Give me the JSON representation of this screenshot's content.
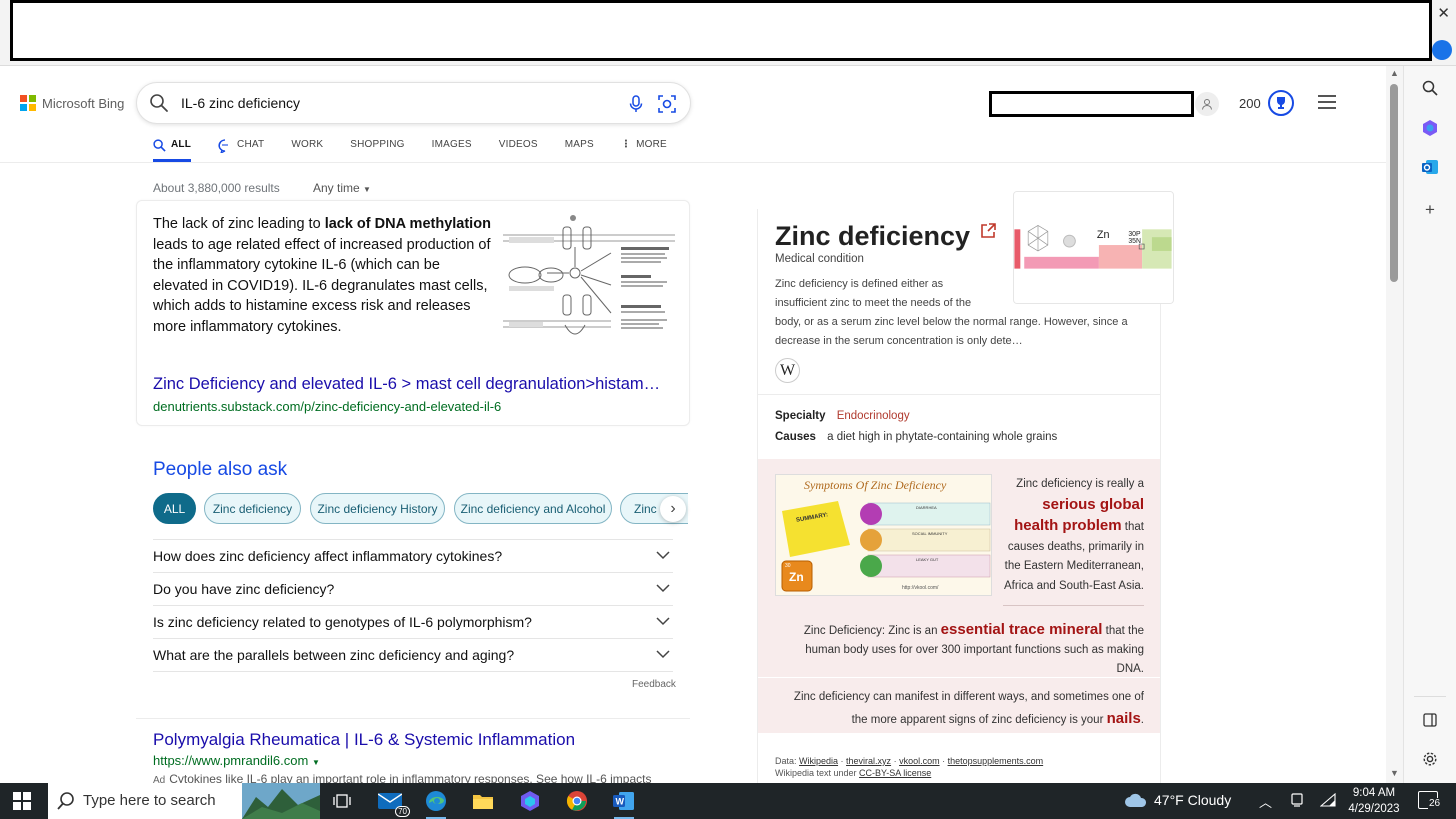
{
  "browser": {
    "close_glyph": "✕"
  },
  "header": {
    "logo_text": "Microsoft Bing",
    "search_query": "IL-6 zinc deficiency",
    "rewards_points": "200"
  },
  "nav_tabs": [
    {
      "label": "ALL",
      "icon": "search-icon",
      "active": true
    },
    {
      "label": "CHAT",
      "icon": "chat-icon",
      "active": false
    },
    {
      "label": "WORK",
      "active": false
    },
    {
      "label": "SHOPPING",
      "active": false
    },
    {
      "label": "IMAGES",
      "active": false
    },
    {
      "label": "VIDEOS",
      "active": false
    },
    {
      "label": "MAPS",
      "active": false
    },
    {
      "label": "MORE",
      "icon": "more-vertical-icon",
      "active": false
    }
  ],
  "results_meta": {
    "count": "About 3,880,000 results",
    "time_filter": "Any time"
  },
  "answer": {
    "text_1": "The lack of zinc leading to ",
    "text_bold_1": "lack of DNA methylation",
    "text_2": " leads to age related effect of increased production of the inflammatory cytokine IL-6 (which can be elevated in COVID19). IL-6 degranulates mast cells, which adds to histamine excess risk and releases more inflammatory cytokines.",
    "title": "Zinc Deficiency and elevated IL-6 > mast cell degranulation>histam…",
    "url": "denutrients.substack.com/p/zinc-deficiency-and-elevated-il-6"
  },
  "people_also_ask": {
    "heading": "People also ask",
    "chips": [
      "ALL",
      "Zinc deficiency",
      "Zinc deficiency History",
      "Zinc deficiency and Alcohol",
      "Zinc d"
    ],
    "questions": [
      "How does zinc deficiency affect inflammatory cytokines?",
      "Do you have zinc deficiency?",
      "Is zinc deficiency related to genotypes of IL-6 polymorphism?",
      "What are the parallels between zinc deficiency and aging?"
    ],
    "feedback": "Feedback"
  },
  "result_2": {
    "title": "Polymyalgia Rheumatica | IL-6 & Systemic Inflammation",
    "url": "https://www.pmrandil6.com",
    "ad_label": "Ad",
    "snippet": "Cytokines like IL-6 play an important role in inflammatory responses. See how IL-6 impacts"
  },
  "knowledge_panel": {
    "title": "Zinc deficiency",
    "subtitle": "Medical condition",
    "description_lines": [
      "Zinc deficiency is defined either as",
      "insufficient zinc to meet the needs of the",
      "body, or as a serum zinc level below the normal range. However, since a",
      "decrease in the serum concentration is only dete…"
    ],
    "wiki_glyph": "W",
    "facts": [
      {
        "key": "Specialty",
        "value": "Endocrinology",
        "is_link": true
      },
      {
        "key": "Causes",
        "value": "a diet high in phytate-containing whole grains",
        "is_link": false
      }
    ],
    "image_labels": {
      "element": "Zn",
      "p": "30P",
      "n": "35N"
    },
    "infographic": {
      "title": "Symptoms Of Zinc Deficiency",
      "summary_label": "SUMMARY:",
      "badge_number": "30",
      "badge_symbol": "Zn",
      "rows": [
        "DIARRHEA",
        "SOCIAL IMMUNITY",
        "LEAKY GUT"
      ],
      "source": "http://vkool.com/"
    },
    "callout_1": {
      "pre": "Zinc deficiency is really a ",
      "emphasis": "serious global health problem",
      "post": " that causes deaths, primarily in the Eastern Mediterranean, Africa and South-East Asia."
    },
    "callout_2": {
      "pre": "Zinc Deficiency: Zinc is an ",
      "emphasis": "essential trace mineral",
      "post": " that the human body uses for over 300 important functions such as making DNA."
    },
    "callout_3": {
      "pre": "Zinc deficiency can manifest in different ways, and sometimes one of the more apparent signs of zinc deficiency is your ",
      "emphasis": "nails",
      "post": "."
    },
    "sources": {
      "data_label": "Data:",
      "list": [
        "Wikipedia",
        "theviral.xyz",
        "vkool.com",
        "thetopsupplements.com"
      ],
      "license_prefix": "Wikipedia text under ",
      "license": "CC-BY-SA license"
    }
  },
  "taskbar": {
    "search_placeholder": "Type here to search",
    "mail_badge": "70",
    "weather": "47°F  Cloudy",
    "time": "9:04 AM",
    "date": "4/29/2023",
    "notification_count": "26"
  },
  "colors": {
    "accent_blue": "#174ae4",
    "link_blue": "#1a0dab",
    "url_green": "#006d21",
    "chip_teal": "#0f6b8a",
    "kp_red": "#a31414",
    "kp_pink_bg": "#f8ecec"
  }
}
